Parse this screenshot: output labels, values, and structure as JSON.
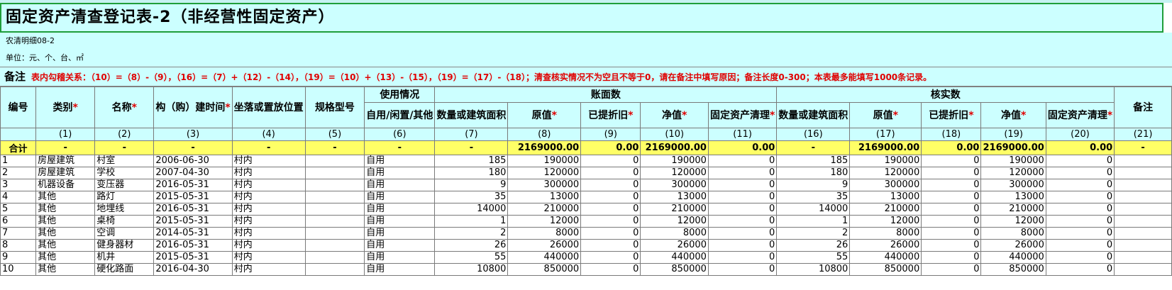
{
  "title": "固定资产清查登记表-2（非经营性固定资产）",
  "subtitle": "农清明细08-2",
  "unit": "单位：元、个、台、㎡",
  "remark": {
    "label": "备注",
    "text": "表内勾稽关系：（10）=（8）-（9），（16）=（7）+（12）-（14），（19）=（10）+（13）-（15），（19）=（17）-（18）；清查核实情况不为空且不等于0，请在备注中填写原因；备注长度0-300；本表最多能填写1000条记录。"
  },
  "header": {
    "no": "编号",
    "category": "类别",
    "name": "名称",
    "build_time": "构（购）建时间",
    "location": "坐落或置放位置",
    "spec": "规格型号",
    "usage": "使用情况",
    "usage_sub": "自用/闲置/其他",
    "book": "账面数",
    "verify": "核实数",
    "qty": "数量或建筑面积",
    "orig": "原值",
    "dep": "已提折旧",
    "net": "净值",
    "clear": "固定资产清理",
    "vqty": "数量或建筑面积",
    "vorig": "原值",
    "vdep": "已提折旧",
    "vnet": "净值",
    "vclear": "固定资产清理",
    "note": "备注",
    "required_mark": "*"
  },
  "col_numbers": [
    "(1)",
    "(2)",
    "(3)",
    "(4)",
    "(5)",
    "(6)",
    "(7)",
    "(8)",
    "(9)",
    "(10)",
    "(11)",
    "(16)",
    "(17)",
    "(18)",
    "(19)",
    "(20)",
    "(21)"
  ],
  "total_row": [
    "合计",
    "-",
    "-",
    "-",
    "-",
    "-",
    "-",
    "-",
    "2169000.00",
    "0.00",
    "2169000.00",
    "0.00",
    "-",
    "2169000.00",
    "0.00",
    "2169000.00",
    "0.00",
    "-"
  ],
  "rows": [
    [
      "1",
      "房屋建筑",
      "村室",
      "2006-06-30",
      "村内",
      "",
      "自用",
      "185",
      "190000",
      "0",
      "190000",
      "0",
      "185",
      "190000",
      "0",
      "190000",
      "0",
      ""
    ],
    [
      "2",
      "房屋建筑",
      "学校",
      "2007-04-30",
      "村内",
      "",
      "自用",
      "180",
      "120000",
      "0",
      "120000",
      "0",
      "180",
      "120000",
      "0",
      "120000",
      "0",
      ""
    ],
    [
      "3",
      "机器设备",
      "变压器",
      "2016-05-31",
      "村内",
      "",
      "自用",
      "9",
      "300000",
      "0",
      "300000",
      "0",
      "9",
      "300000",
      "0",
      "300000",
      "0",
      ""
    ],
    [
      "4",
      "其他",
      "路灯",
      "2015-05-31",
      "村内",
      "",
      "自用",
      "35",
      "13000",
      "0",
      "13000",
      "0",
      "35",
      "13000",
      "0",
      "13000",
      "0",
      ""
    ],
    [
      "5",
      "其他",
      "地埋线",
      "2016-05-31",
      "村内",
      "",
      "自用",
      "14000",
      "210000",
      "0",
      "210000",
      "0",
      "14000",
      "210000",
      "0",
      "210000",
      "0",
      ""
    ],
    [
      "6",
      "其他",
      "桌椅",
      "2015-05-31",
      "村内",
      "",
      "自用",
      "1",
      "12000",
      "0",
      "12000",
      "0",
      "1",
      "12000",
      "0",
      "12000",
      "0",
      ""
    ],
    [
      "7",
      "其他",
      "空调",
      "2014-05-31",
      "村内",
      "",
      "自用",
      "2",
      "8000",
      "0",
      "8000",
      "0",
      "2",
      "8000",
      "0",
      "8000",
      "0",
      ""
    ],
    [
      "8",
      "其他",
      "健身器材",
      "2016-05-31",
      "村内",
      "",
      "自用",
      "26",
      "26000",
      "0",
      "26000",
      "0",
      "26",
      "26000",
      "0",
      "26000",
      "0",
      ""
    ],
    [
      "9",
      "其他",
      "机井",
      "2015-05-31",
      "村内",
      "",
      "自用",
      "55",
      "440000",
      "0",
      "440000",
      "0",
      "55",
      "440000",
      "0",
      "440000",
      "0",
      ""
    ],
    [
      "10",
      "其他",
      "硬化路面",
      "2016-04-30",
      "村内",
      "",
      "自用",
      "10800",
      "850000",
      "0",
      "850000",
      "0",
      "10800",
      "850000",
      "0",
      "850000",
      "0",
      ""
    ]
  ]
}
